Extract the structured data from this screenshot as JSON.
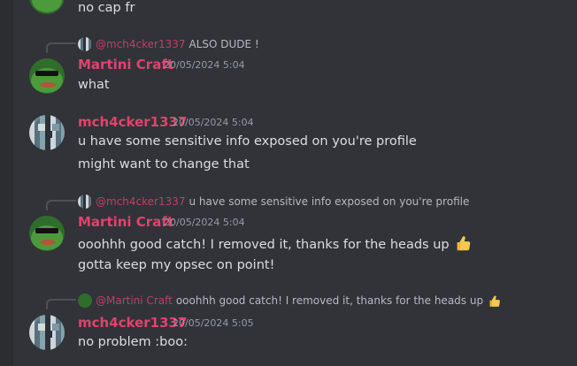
{
  "messages": [
    {
      "author": "",
      "timestamp": "",
      "lines": [
        "no cap fr"
      ]
    },
    {
      "reply": {
        "name": "@mch4cker1337",
        "text": "ALSO DUDE !"
      },
      "author": "Martini Craft",
      "timestamp": "20/05/2024 5:04",
      "lines": [
        "what"
      ]
    },
    {
      "author": "mch4cker1337",
      "timestamp": "20/05/2024 5:04",
      "lines": [
        "u have some sensitive info exposed on you're profile",
        "might want to change that"
      ]
    },
    {
      "reply": {
        "name": "@mch4cker1337",
        "text": "u have some sensitive info exposed on you're profile"
      },
      "author": "Martini Craft",
      "timestamp": "20/05/2024 5:04",
      "lines": [
        "ooohhh good catch! I removed it, thanks for the heads up",
        "gotta keep my opsec on point!"
      ]
    },
    {
      "reply": {
        "name": "@Martini Craft",
        "text": "ooohhh good catch! I removed it, thanks for the heads up"
      },
      "author": "mch4cker1337",
      "timestamp": "20/05/2024 5:05",
      "lines": [
        "no problem :boo:"
      ]
    }
  ],
  "icons": {
    "thumbs_up": "thumbs-up-emoji",
    "frog_avatar": "pepe-frog-avatar",
    "pixel_avatar": "pixel-avatar"
  },
  "colors": {
    "background": "#313338",
    "username": "#e0436e",
    "text": "#dbdee1",
    "timestamp": "#949ba4"
  }
}
